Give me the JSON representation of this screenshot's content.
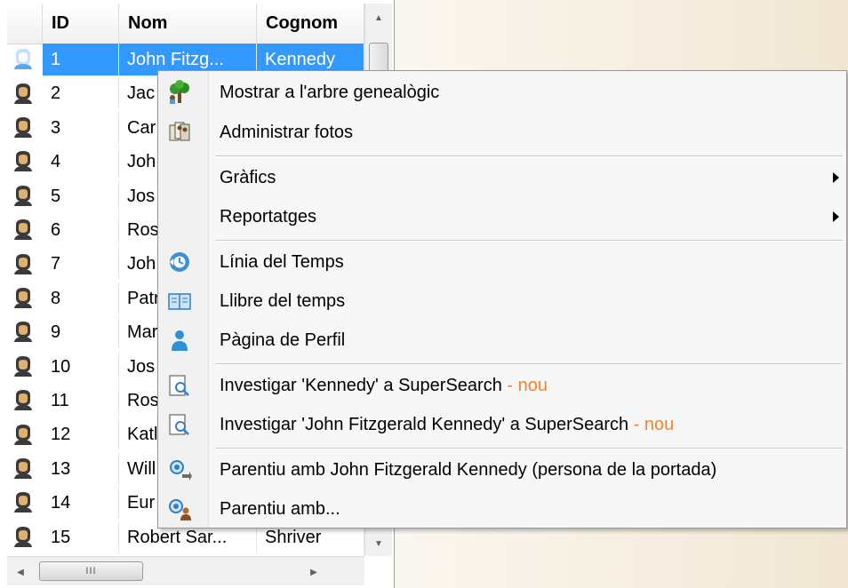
{
  "grid": {
    "columns": [
      "ID",
      "Nom",
      "Cognom"
    ],
    "rows": [
      {
        "id": "1",
        "nom": "John Fitzg...",
        "cognom": "Kennedy",
        "selected": true
      },
      {
        "id": "2",
        "nom": "Jac",
        "cognom": ""
      },
      {
        "id": "3",
        "nom": "Car",
        "cognom": ""
      },
      {
        "id": "4",
        "nom": "Joh",
        "cognom": ""
      },
      {
        "id": "5",
        "nom": "Jos",
        "cognom": ""
      },
      {
        "id": "6",
        "nom": "Ros",
        "cognom": ""
      },
      {
        "id": "7",
        "nom": "Joh",
        "cognom": ""
      },
      {
        "id": "8",
        "nom": "Patr",
        "cognom": ""
      },
      {
        "id": "9",
        "nom": "Mar",
        "cognom": ""
      },
      {
        "id": "10",
        "nom": "Jos",
        "cognom": ""
      },
      {
        "id": "11",
        "nom": "Ros",
        "cognom": ""
      },
      {
        "id": "12",
        "nom": "Katl",
        "cognom": ""
      },
      {
        "id": "13",
        "nom": "Will",
        "cognom": ""
      },
      {
        "id": "14",
        "nom": "Eur",
        "cognom": ""
      },
      {
        "id": "15",
        "nom": "Robert Sar...",
        "cognom": "Shriver"
      }
    ],
    "scroll_up_glyph": "▲",
    "scroll_down_glyph": "▼",
    "scroll_left_glyph": "◀",
    "scroll_right_glyph": "▶",
    "hthumb_grip": "III"
  },
  "menu": {
    "items": [
      {
        "label": "Mostrar a l'arbre genealògic",
        "icon": "family-tree-icon"
      },
      {
        "label": "Administrar fotos",
        "icon": "photos-icon"
      },
      {
        "label": "Gràfics",
        "submenu": true
      },
      {
        "label": "Reportatges",
        "submenu": true
      },
      {
        "label": "Línia del Temps",
        "icon": "timeline-icon"
      },
      {
        "label": "Llibre del temps",
        "icon": "book-icon"
      },
      {
        "label": "Pàgina de Perfil",
        "icon": "profile-icon"
      },
      {
        "label": "Investigar 'Kennedy' a SuperSearch",
        "badge": "- nou",
        "icon": "supersearch-icon"
      },
      {
        "label": "Investigar 'John Fitzgerald Kennedy' a SuperSearch",
        "badge": "- nou",
        "icon": "supersearch-icon"
      },
      {
        "label": "Parentiu amb John Fitzgerald Kennedy (persona de la portada)",
        "icon": "relationship-icon"
      },
      {
        "label": "Parentiu amb...",
        "icon": "relationship-people-icon"
      }
    ]
  },
  "colors": {
    "selection": "#3399ff",
    "badge": "#ff7f27",
    "icon_blue": "#2f8fd8"
  }
}
